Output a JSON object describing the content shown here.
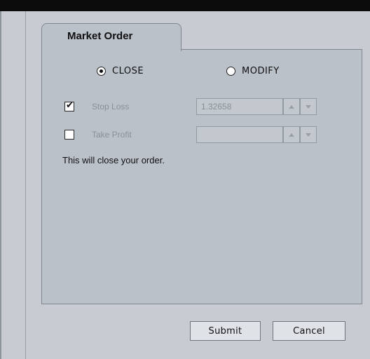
{
  "dialog": {
    "tab_title": "Market Order",
    "mode": {
      "selected": "close",
      "close_label": "CLOSE",
      "modify_label": "MODIFY"
    },
    "stop_loss": {
      "label": "Stop Loss",
      "checked": true,
      "value": "1.32658",
      "enabled": false
    },
    "take_profit": {
      "label": "Take Profit",
      "checked": false,
      "value": "",
      "enabled": false
    },
    "message": "This will close your order.",
    "buttons": {
      "submit_label": "Submit",
      "cancel_label": "Cancel"
    }
  },
  "icons": {
    "radio_selected": "radio-selected-icon",
    "radio_unselected": "radio-unselected-icon",
    "checkbox_checked": "checkbox-checked-icon",
    "spin_up": "arrow-up-icon",
    "spin_down": "arrow-down-icon"
  },
  "colors": {
    "panel_bg": "#bbc1c9",
    "window_bg": "#c8ccd2",
    "disabled_text": "#8a9098",
    "title_bar": "#0c0c0c"
  }
}
